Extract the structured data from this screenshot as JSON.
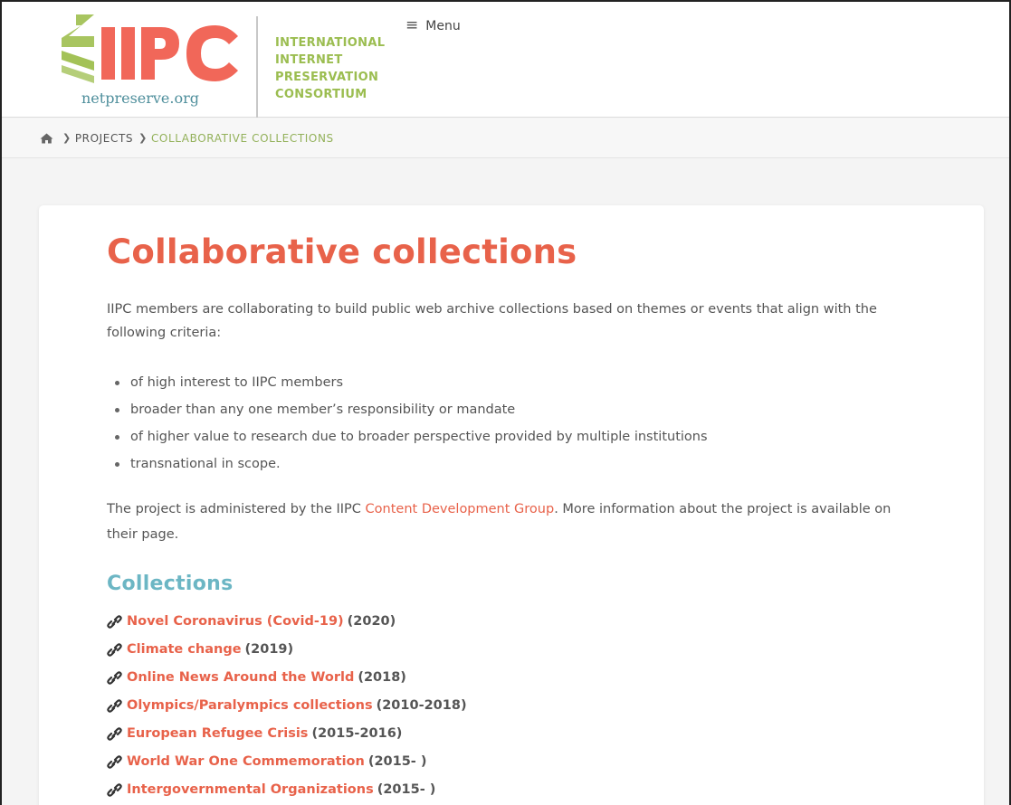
{
  "header": {
    "logo": {
      "wordmark": "IIPC",
      "site": "netpreserve.org",
      "name_lines": [
        "INTERNATIONAL",
        "INTERNET",
        "PRESERVATION",
        "CONSORTIUM"
      ]
    },
    "menu_label": "Menu"
  },
  "breadcrumb": {
    "items": [
      "PROJECTS",
      "COLLABORATIVE COLLECTIONS"
    ]
  },
  "page": {
    "title": "Collaborative collections",
    "intro": "IIPC members are collaborating to build public web archive collections based on themes or events that align with the following criteria:",
    "criteria": [
      "of high interest to IIPC members",
      "broader than any one member’s responsibility or mandate",
      "of higher value to research due to broader perspective provided by multiple institutions",
      "transnational in scope."
    ],
    "admin_before": "The project is administered by the IIPC ",
    "admin_link": "Content Development Group",
    "admin_after": ". More information about the project is available on their page.",
    "collections_heading": "Collections",
    "collections": [
      {
        "name": "Novel Coronavirus (Covid-19)",
        "years": "(2020)"
      },
      {
        "name": "Climate change",
        "years": "(2019)"
      },
      {
        "name": "Online News Around the World",
        "years": "(2018)"
      },
      {
        "name": "Olympics/Paralympics collections",
        "years": "(2010-2018)"
      },
      {
        "name": "European Refugee Crisis",
        "years": "(2015-2016)"
      },
      {
        "name": "World War One Commemoration",
        "years": "(2015- )"
      },
      {
        "name": "Intergovernmental Organizations",
        "years": "(2015- )"
      }
    ]
  },
  "colors": {
    "accent": "#e8624a",
    "heading2": "#6cb6c4",
    "logo_green": "#9bbd50",
    "logo_red": "#f05a4b"
  },
  "icons": {
    "home": "home-icon",
    "separator": "chevron-right-icon",
    "menu": "hamburger-icon",
    "collection_link": "link-icon"
  }
}
